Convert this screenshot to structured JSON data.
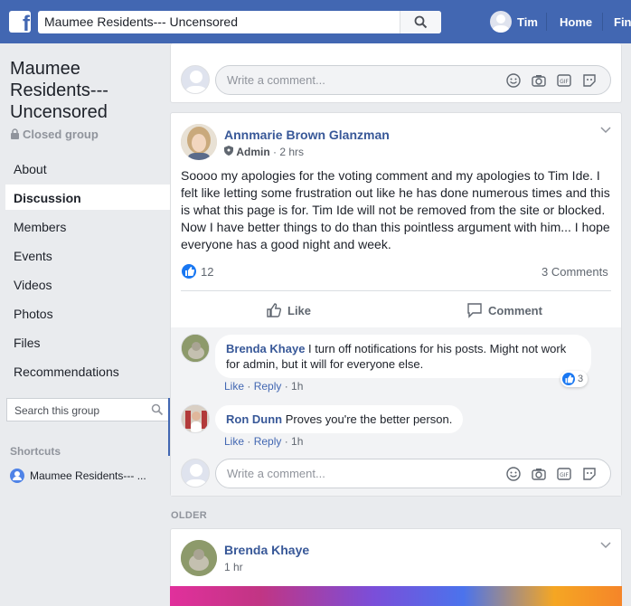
{
  "topbar": {
    "search_value": "Maumee Residents--- Uncensored",
    "user_name": "Tim",
    "home_label": "Home",
    "find_label": "Fin"
  },
  "sidebar": {
    "group_name": "Maumee Residents--- Uncensored",
    "group_type": "Closed group",
    "items": [
      {
        "label": "About"
      },
      {
        "label": "Discussion"
      },
      {
        "label": "Members"
      },
      {
        "label": "Events"
      },
      {
        "label": "Videos"
      },
      {
        "label": "Photos"
      },
      {
        "label": "Files"
      },
      {
        "label": "Recommendations"
      }
    ],
    "active_item": "Discussion",
    "search_placeholder": "Search this group",
    "shortcuts_label": "Shortcuts",
    "shortcut_item": "Maumee Residents--- ..."
  },
  "comment_placeholder": "Write a comment...",
  "post": {
    "author": "Annmarie Brown Glanzman",
    "role": "Admin",
    "time": "2 hrs",
    "body": "Soooo my apologies for the voting comment and my apologies to Tim Ide. I felt like letting some frustration out like he has done numerous times and this is what this page is for. Tim Ide will not be removed from the site or blocked. Now I have better things to do than this pointless argument with him... I hope everyone has a good night and week.",
    "likes": "12",
    "comments": "3 Comments",
    "like_label": "Like",
    "comment_label": "Comment"
  },
  "replies": [
    {
      "name": "Brenda Khaye",
      "text": "I turn off notifications for his posts. Might not work for admin, but it will for everyone else.",
      "like": "Like",
      "reply": "Reply",
      "time": "1h",
      "reactions": "3"
    },
    {
      "name": "Ron Dunn",
      "text": "Proves you're the better person.",
      "like": "Like",
      "reply": "Reply",
      "time": "1h"
    }
  ],
  "older_label": "OLDER",
  "next_post": {
    "author": "Brenda Khaye",
    "time": "1 hr"
  },
  "colors": {
    "brand": "#4267b2",
    "link": "#385898",
    "like": "#1877f2"
  },
  "icons": [
    "facebook-logo-icon",
    "search-icon",
    "lock-icon",
    "shield-icon",
    "chevron-down-icon",
    "like-icon",
    "comment-icon",
    "emoji-icon",
    "camera-icon",
    "gif-icon",
    "sticker-icon",
    "group-icon"
  ]
}
